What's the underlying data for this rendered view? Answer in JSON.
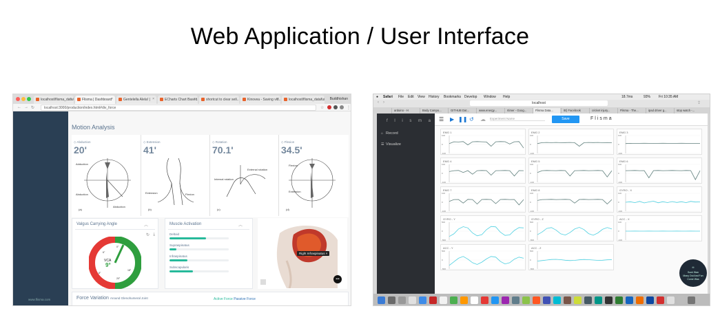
{
  "slide": {
    "title": "Web Application / User Interface"
  },
  "left": {
    "tabs": [
      "localhost/flisma_data/ui...",
      "Flisma | Dashboard",
      "Gentelella Alela! |",
      "ECharts Chart Based...",
      "shortcut to clear ses...",
      "Kinovea - Saving vid...",
      "localhost/flisma_data/ui..."
    ],
    "profile": "Buddhishan",
    "url": "localhost:3000/production/index.html#div_force",
    "sidebar_footer": "www.flisma.com",
    "heading": "Motion Analysis",
    "motions": [
      {
        "label": "Abduction",
        "value": "20'",
        "figure": "(a)"
      },
      {
        "label": "Extension",
        "value": "41'",
        "figure": "(b)"
      },
      {
        "label": "Rotation",
        "value": "70.1'",
        "figure": "(c)"
      },
      {
        "label": "Flexion",
        "value": "34.5'",
        "figure": "(d)"
      }
    ],
    "fig_labels": {
      "adduction": "Adduction",
      "abduction": "Abduction",
      "extension": "Extension",
      "flexion": "Flexion",
      "internal_rotation": "Internal rotation",
      "external_rotation": "External rotation"
    },
    "valgus": {
      "title": "Valgus Carrying Angle",
      "vca_label": "VCA",
      "vca_value": "9°",
      "tick_0": "0°",
      "tick_18": "18°",
      "tick_20": "20°",
      "tick_6": "6°",
      "tick_neg": "8°"
    },
    "muscle": {
      "title": "Muscle Activation",
      "items": [
        {
          "name": "Deltoid",
          "level": 0.62
        },
        {
          "name": "Supraspinatus",
          "level": 0.12
        },
        {
          "name": "Infraspinatus",
          "level": 0.3
        },
        {
          "name": "Subscapularis",
          "level": 0.4
        }
      ]
    },
    "shoulder": {
      "tag": "Right Infraspinatus",
      "tag_close": "×",
      "more": "•••"
    },
    "force": {
      "title": "Force Variation",
      "subtitle": "Around Glenohumeral Joint",
      "active": "Active Force",
      "passive": "Passive Force"
    },
    "colors": {
      "sidebar": "#2a3f54",
      "accent": "#26b99a",
      "gauge_red": "#e53935",
      "gauge_green": "#2e9e3e"
    }
  },
  "right": {
    "menu": [
      "Safari",
      "File",
      "Edit",
      "View",
      "History",
      "Bookmarks",
      "Develop",
      "Window",
      "Help"
    ],
    "status": {
      "temp": "18.7ms",
      "battery": "93%",
      "clock": "Fri 10:35 AM"
    },
    "address": "localhost",
    "tabs": [
      "arduino - H",
      "Body Compo...",
      "GITHUB Dat...",
      "www.energy...",
      "rtimer - Goog...",
      "Flisma Data...",
      "IB) Facebook",
      "cricket injury...",
      "Flisma - The...",
      "ipad driver g...",
      "stop watch -..."
    ],
    "app_logo": "f l i s m a",
    "nav": [
      {
        "label": "Record",
        "icon": "home-icon"
      },
      {
        "label": "Visualize",
        "icon": "list-icon"
      }
    ],
    "toolbar": {
      "placeholder": "Experiment Name",
      "save": "Save",
      "brand": "Flisma"
    },
    "chart_data": [
      {
        "type": "line",
        "title": "EMG 1",
        "ylim": [
          -100,
          100
        ],
        "yticks": [
          "100",
          "0",
          "-100"
        ],
        "series": [
          {
            "values": [
              10,
              30,
              28,
              32,
              -5,
              30,
              32,
              30,
              28,
              -20,
              30,
              32,
              31,
              5,
              30,
              32,
              -40
            ]
          }
        ]
      },
      {
        "type": "line",
        "title": "EMG 2",
        "ylim": [
          -100,
          100
        ],
        "yticks": [
          "100",
          "0",
          "-100"
        ],
        "series": [
          {
            "values": [
              10,
              20,
              22,
              20,
              22,
              20,
              21,
              22,
              20,
              -20,
              20,
              22,
              21,
              22,
              20,
              21,
              20
            ]
          }
        ]
      },
      {
        "type": "line",
        "title": "EMG 3",
        "ylim": [
          -100,
          100
        ],
        "yticks": [
          "100",
          "0",
          "-100"
        ],
        "series": [
          {
            "values": [
              10,
              12,
              11,
              12,
              13,
              12,
              11,
              12,
              13,
              12,
              11,
              12,
              13,
              12,
              11,
              12,
              12
            ]
          }
        ]
      },
      {
        "type": "line",
        "title": "EMG 4",
        "ylim": [
          -100,
          100
        ],
        "yticks": [
          "100",
          "0",
          "-100"
        ],
        "series": [
          {
            "values": [
              20,
              30,
              32,
              10,
              31,
              -10,
              30,
              32,
              31,
              -20,
              30,
              31,
              32,
              30,
              -30,
              31,
              30
            ]
          }
        ]
      },
      {
        "type": "line",
        "title": "EMG 5",
        "ylim": [
          -100,
          100
        ],
        "yticks": [
          "100",
          "0",
          "-100"
        ],
        "series": [
          {
            "values": [
              10,
              30,
              32,
              31,
              30,
              32,
              31,
              -30,
              30,
              31,
              32,
              30,
              31,
              32,
              30,
              -40,
              30
            ]
          }
        ]
      },
      {
        "type": "line",
        "title": "EMG 6",
        "ylim": [
          -100,
          100
        ],
        "yticks": [
          "100",
          "0",
          "-100"
        ],
        "series": [
          {
            "values": [
              30,
              31,
              32,
              30,
              31,
              -50,
              31,
              32,
              30,
              31,
              32,
              31,
              30,
              32,
              31,
              -70,
              30
            ]
          }
        ]
      },
      {
        "type": "line",
        "title": "EMG 7",
        "ylim": [
          -100,
          100
        ],
        "yticks": [
          "100",
          "0",
          "-100"
        ],
        "series": [
          {
            "values": [
              10,
              30,
              31,
              -10,
              32,
              30,
              -20,
              31,
              32,
              30,
              -15,
              31,
              32,
              30,
              31,
              -30,
              30
            ]
          }
        ]
      },
      {
        "type": "line",
        "title": "EMG 8",
        "ylim": [
          -100,
          100
        ],
        "yticks": [
          "100",
          "0",
          "-100"
        ],
        "series": [
          {
            "values": [
              20,
              30,
              31,
              32,
              30,
              31,
              32,
              30,
              -10,
              31,
              32,
              30,
              31,
              32,
              30,
              -20,
              30
            ]
          }
        ]
      },
      {
        "type": "line",
        "title": "GYRO - X",
        "ylim": [
          -100,
          100
        ],
        "yticks": [
          "100",
          "0",
          "-100"
        ],
        "series": [
          {
            "values": [
              0,
              5,
              -5,
              10,
              -8,
              4,
              12,
              -6,
              6,
              -4,
              8,
              -2,
              6,
              -5,
              10,
              2,
              4
            ]
          }
        ]
      },
      {
        "type": "line",
        "title": "GYRO - Y",
        "ylim": [
          -500,
          500
        ],
        "yticks": [
          "500",
          "0",
          "-500"
        ],
        "series": [
          {
            "values": [
              -300,
              -150,
              120,
              250,
              180,
              -100,
              -260,
              -200,
              80,
              260,
              240,
              -60,
              -240,
              -210,
              40,
              200,
              180
            ]
          }
        ]
      },
      {
        "type": "line",
        "title": "GYRO - Z",
        "ylim": [
          -500,
          500
        ],
        "yticks": [
          "500",
          "0",
          "-500"
        ],
        "series": [
          {
            "values": [
              -200,
              -50,
              150,
              200,
              60,
              -150,
              -220,
              -80,
              120,
              210,
              90,
              -140,
              -230,
              -100,
              100,
              200,
              120
            ]
          }
        ]
      },
      {
        "type": "line",
        "title": "ACC - X",
        "ylim": [
          -100,
          100
        ],
        "yticks": [
          "100",
          "0",
          "-100"
        ],
        "series": [
          {
            "values": [
              0,
              0,
              1,
              0,
              0,
              1,
              0,
              0,
              1,
              0,
              0,
              1,
              0,
              0,
              1,
              0,
              0
            ]
          }
        ]
      },
      {
        "type": "line",
        "title": "ACC - Y",
        "ylim": [
          -500,
          500
        ],
        "yticks": [
          "500",
          "0",
          "-500"
        ],
        "series": [
          {
            "values": [
              -300,
              -100,
              100,
              200,
              50,
              -150,
              -250,
              -120,
              60,
              200,
              160,
              -80,
              -220,
              -150,
              50,
              160,
              100
            ]
          }
        ]
      },
      {
        "type": "line",
        "title": "ACC - Z",
        "ylim": [
          -500,
          500
        ],
        "yticks": [
          "500",
          "0",
          "-500"
        ],
        "series": [
          {
            "values": [
              -60,
              -30,
              0,
              30,
              40,
              20,
              -10,
              -30,
              -20,
              10,
              30,
              20,
              0,
              -20,
              -10,
              10,
              20
            ]
          }
        ]
      }
    ],
    "chat": {
      "line1": "Sumi Wan",
      "line2": "Many Out And Fun",
      "line3": "Come Was"
    },
    "colors": {
      "sidebar": "#2b2e33",
      "save": "#2196f3",
      "emg_line": "#5f7f7c",
      "gyro_line": "#4dd0e1"
    }
  }
}
